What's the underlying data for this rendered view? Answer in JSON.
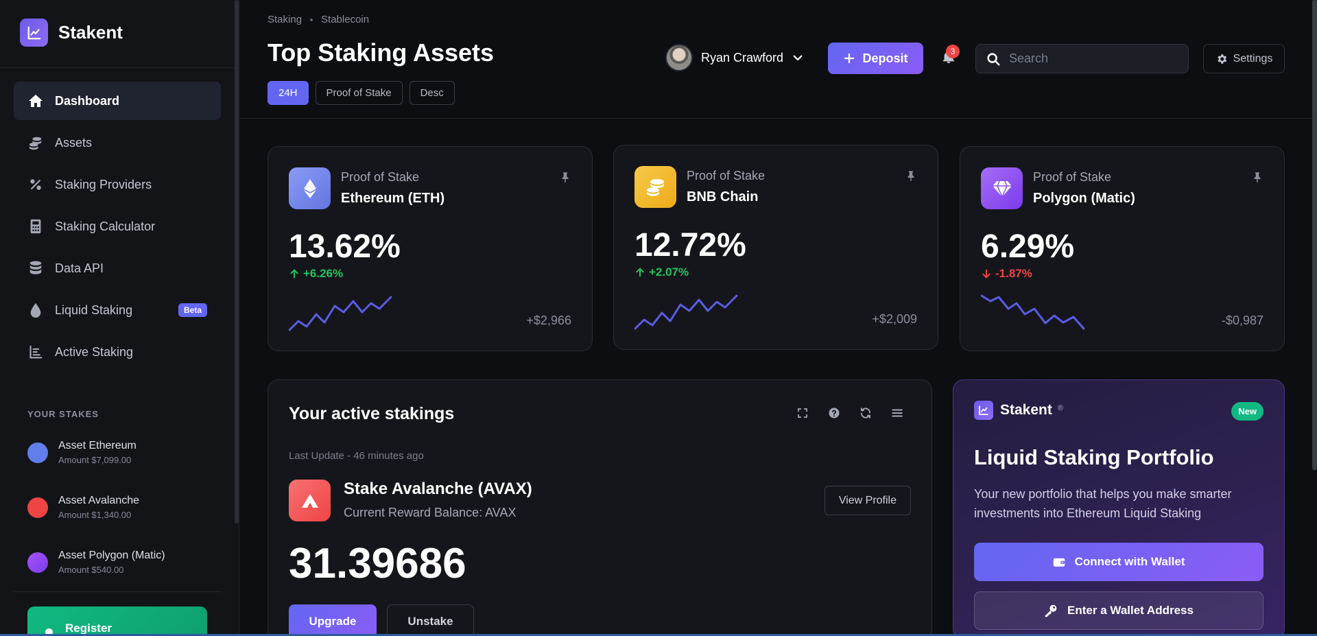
{
  "app": {
    "name": "Stakent"
  },
  "sidebar": {
    "items": [
      {
        "label": "Dashboard",
        "icon": "home-icon"
      },
      {
        "label": "Assets",
        "icon": "coins-icon"
      },
      {
        "label": "Staking Providers",
        "icon": "percent-icon"
      },
      {
        "label": "Staking Calculator",
        "icon": "calculator-icon"
      },
      {
        "label": "Data API",
        "icon": "database-icon"
      },
      {
        "label": "Liquid Staking",
        "icon": "droplet-icon",
        "badge": "Beta"
      },
      {
        "label": "Active Staking",
        "icon": "bar-chart-icon"
      }
    ],
    "stakes_title": "YOUR STAKES",
    "stakes": [
      {
        "name": "Asset Ethereum",
        "amount": "Amount $7,099.00",
        "color": "#627eea"
      },
      {
        "name": "Asset Avalanche",
        "amount": "Amount $1,340.00",
        "color": "#ef4444"
      },
      {
        "name": "Asset Polygon (Matic)",
        "amount": "Amount $540.00",
        "color": "#8b5cf6"
      }
    ],
    "register_label": "Register"
  },
  "header": {
    "breadcrumb": [
      "Staking",
      "Stablecoin"
    ],
    "title": "Top Staking Assets",
    "filters": [
      "24H",
      "Proof of Stake",
      "Desc"
    ],
    "user_name": "Ryan Crawford",
    "deposit_label": "Deposit",
    "notification_count": "3",
    "search_placeholder": "Search",
    "settings_label": "Settings"
  },
  "cards": [
    {
      "category": "Proof of Stake",
      "name": "Ethereum (ETH)",
      "percent": "13.62%",
      "change": "+6.26%",
      "direction": "up",
      "value": "+$2,966",
      "color": "#7b8cf0"
    },
    {
      "category": "Proof of Stake",
      "name": "BNB Chain",
      "percent": "12.72%",
      "change": "+2.07%",
      "direction": "up",
      "value": "+$2,009",
      "color": "#f3ba2f"
    },
    {
      "category": "Proof of Stake",
      "name": "Polygon (Matic)",
      "percent": "6.29%",
      "change": "-1.87%",
      "direction": "down",
      "value": "-$0,987",
      "color": "#9f5cf0"
    }
  ],
  "active": {
    "title": "Your active stakings",
    "last_update": "Last Update - 46 minutes ago",
    "stake_title": "Stake Avalanche (AVAX)",
    "stake_sub": "Current Reward Balance: AVAX",
    "view_profile": "View Profile",
    "reward": "31.39686",
    "upgrade": "Upgrade",
    "unstake": "Unstake"
  },
  "promo": {
    "brand": "Stakent",
    "registered_mark": "®",
    "badge": "New",
    "title": "Liquid Staking Portfolio",
    "description": "Your new portfolio that helps you make smarter investments into Ethereum Liquid Staking",
    "connect_label": "Connect with Wallet",
    "enter_label": "Enter a Wallet Address"
  },
  "colors": {
    "accent": "#6366f1",
    "positive": "#22c55e",
    "negative": "#ef4444",
    "spark": "#5b5ce6"
  }
}
